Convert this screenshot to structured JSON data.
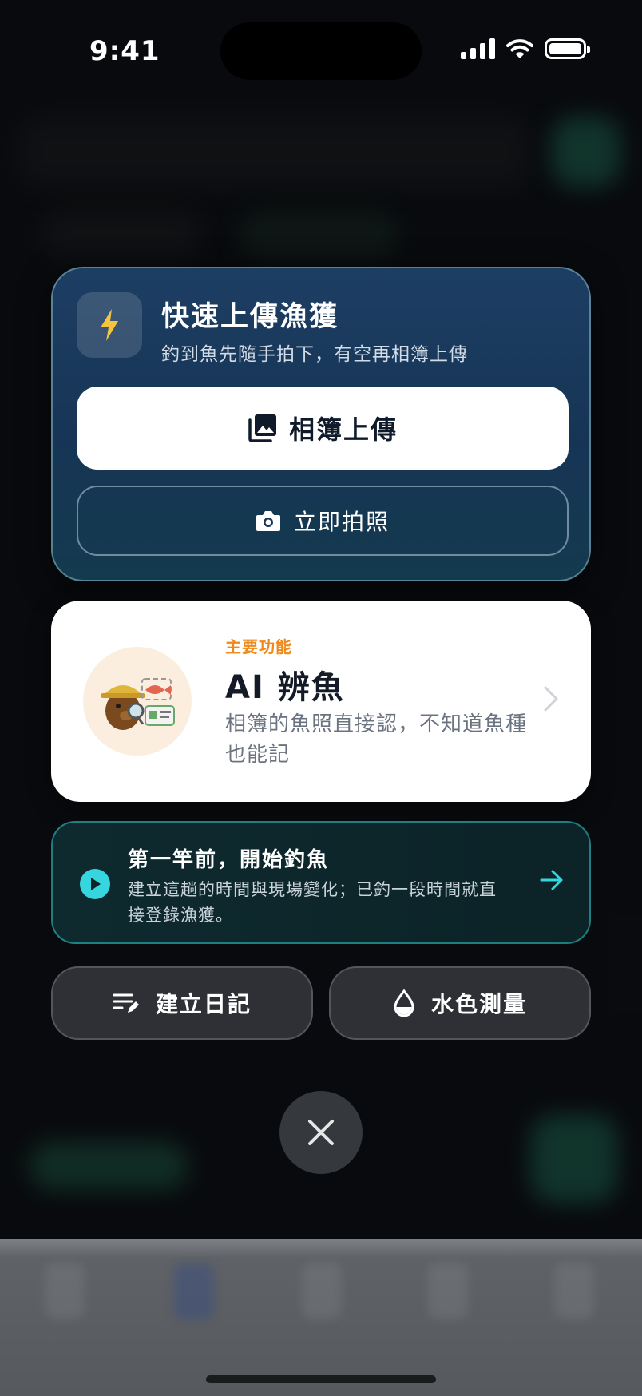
{
  "status_bar": {
    "time": "9:41"
  },
  "quick_upload": {
    "title": "快速上傳漁獲",
    "subtitle": "釣到魚先隨手拍下，有空再相簿上傳",
    "album_button": "相簿上傳",
    "camera_button": "立即拍照"
  },
  "ai_feature": {
    "tag": "主要功能",
    "title": "AI 辨魚",
    "description": "相簿的魚照直接認，不知道魚種也能記"
  },
  "start_fishing": {
    "title": "第一竿前，開始釣魚",
    "description": "建立這趟的時間與現場變化；已釣一段時間就直接登錄漁獲。"
  },
  "actions": {
    "diary_label": "建立日記",
    "water_label": "水色測量"
  },
  "icons": {
    "quick": "lightning-icon",
    "album": "photo-album-icon",
    "camera": "camera-icon",
    "chevron": "chevron-right-icon",
    "play": "play-icon",
    "arrow": "arrow-right-icon",
    "diary": "edit-list-icon",
    "water": "water-drop-icon",
    "close": "close-icon"
  },
  "colors": {
    "accent_orange": "#ee8a1b",
    "accent_teal": "#35d6e0",
    "bolt_yellow": "#f5c542"
  }
}
